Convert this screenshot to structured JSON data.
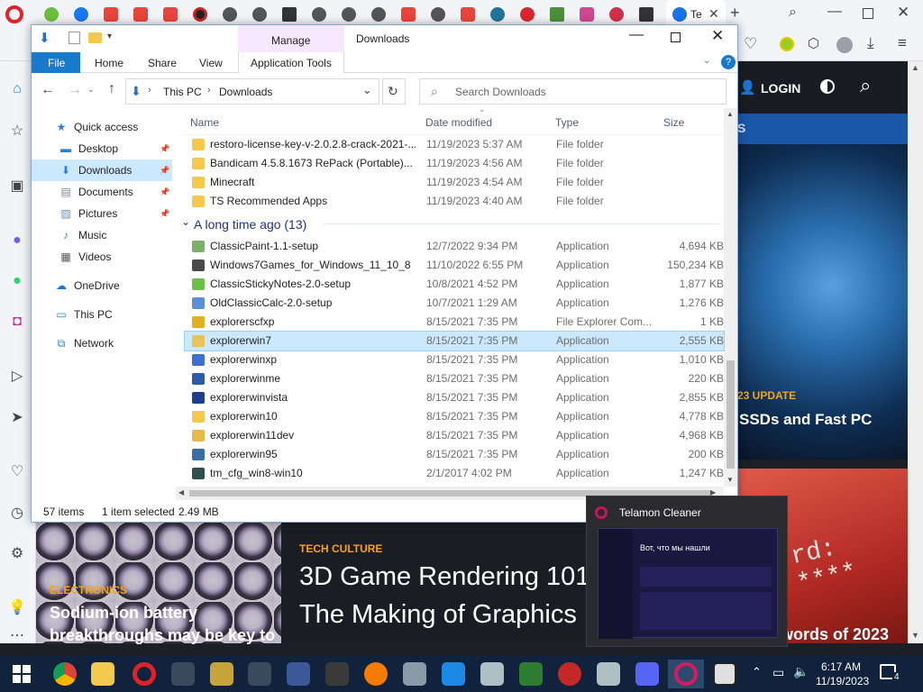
{
  "browser": {
    "active_tab_label": "Te",
    "login_label": "LOGIN"
  },
  "website": {
    "banner_partial": "S",
    "update_label": "23 UPDATE",
    "ssd_title": "SSDs and Fast PC",
    "card1": {
      "category": "ELECTRONICS",
      "title_line1": "Sodium-ion battery",
      "title_line2": "breakthroughs may be key to"
    },
    "card2": {
      "category": "TECH CULTURE",
      "title_line1": "3D Game Rendering 101:",
      "title_line2": "The Making of Graphics"
    },
    "card3": {
      "password_text": "rd: ****",
      "title": "words of 2023"
    }
  },
  "explorer": {
    "ribbon_manage": "Manage",
    "window_title": "Downloads",
    "ribbon_tabs": [
      "File",
      "Home",
      "Share",
      "View",
      "Application Tools"
    ],
    "breadcrumb": [
      "This PC",
      "Downloads"
    ],
    "search_placeholder": "Search Downloads",
    "columns": {
      "name": "Name",
      "date": "Date modified",
      "type": "Type",
      "size": "Size"
    },
    "group_label": "A long time ago (13)",
    "nav": [
      {
        "label": "Quick access",
        "icon": "star-icon"
      },
      {
        "label": "Desktop",
        "icon": "desktop-icon"
      },
      {
        "label": "Downloads",
        "icon": "download-icon"
      },
      {
        "label": "Documents",
        "icon": "documents-icon"
      },
      {
        "label": "Pictures",
        "icon": "pictures-icon"
      },
      {
        "label": "Music",
        "icon": "music-icon"
      },
      {
        "label": "Videos",
        "icon": "videos-icon"
      },
      {
        "label": "OneDrive",
        "icon": "cloud-icon"
      },
      {
        "label": "This PC",
        "icon": "pc-icon"
      },
      {
        "label": "Network",
        "icon": "network-icon"
      }
    ],
    "recent_files": [
      {
        "name": "restoro-license-key-v-2.0.2.8-crack-2021-...",
        "date": "11/19/2023 5:37 AM",
        "type": "File folder",
        "size": "",
        "color": "#f2c94c"
      },
      {
        "name": "Bandicam 4.5.8.1673 RePack (Portable)...",
        "date": "11/19/2023 4:56 AM",
        "type": "File folder",
        "size": "",
        "color": "#f2c94c"
      },
      {
        "name": "Minecraft",
        "date": "11/19/2023 4:54 AM",
        "type": "File folder",
        "size": "",
        "color": "#f2c94c"
      },
      {
        "name": "TS Recommended Apps",
        "date": "11/19/2023 4:40 AM",
        "type": "File folder",
        "size": "",
        "color": "#f2c94c"
      }
    ],
    "old_files": [
      {
        "name": "ClassicPaint-1.1-setup",
        "date": "12/7/2022 9:34 PM",
        "type": "Application",
        "size": "4,694 KB",
        "color": "#7fb069"
      },
      {
        "name": "Windows7Games_for_Windows_11_10_8",
        "date": "11/10/2022 6:55 PM",
        "type": "Application",
        "size": "150,234 KB",
        "color": "#4a4a4a"
      },
      {
        "name": "ClassicStickyNotes-2.0-setup",
        "date": "10/8/2021 4:52 PM",
        "type": "Application",
        "size": "1,877 KB",
        "color": "#6cc04a"
      },
      {
        "name": "OldClassicCalc-2.0-setup",
        "date": "10/7/2021 1:29 AM",
        "type": "Application",
        "size": "1,276 KB",
        "color": "#5b8fd6"
      },
      {
        "name": "explorerscfxp",
        "date": "8/15/2021 7:35 PM",
        "type": "File Explorer Com...",
        "size": "1 KB",
        "color": "#e0b020"
      },
      {
        "name": "explorerwin7",
        "date": "8/15/2021 7:35 PM",
        "type": "Application",
        "size": "2,555 KB",
        "color": "#e8c35a"
      },
      {
        "name": "explorerwinxp",
        "date": "8/15/2021 7:35 PM",
        "type": "Application",
        "size": "1,010 KB",
        "color": "#3b6fd1"
      },
      {
        "name": "explorerwinme",
        "date": "8/15/2021 7:35 PM",
        "type": "Application",
        "size": "220 KB",
        "color": "#2e5aa8"
      },
      {
        "name": "explorerwinvista",
        "date": "8/15/2021 7:35 PM",
        "type": "Application",
        "size": "2,855 KB",
        "color": "#1f3f8a"
      },
      {
        "name": "explorerwin10",
        "date": "8/15/2021 7:35 PM",
        "type": "Application",
        "size": "4,778 KB",
        "color": "#f2c94c"
      },
      {
        "name": "explorerwin11dev",
        "date": "8/15/2021 7:35 PM",
        "type": "Application",
        "size": "4,968 KB",
        "color": "#e8b84a"
      },
      {
        "name": "explorerwin95",
        "date": "8/15/2021 7:35 PM",
        "type": "Application",
        "size": "200 KB",
        "color": "#3a6ea5"
      },
      {
        "name": "tm_cfg_win8-win10",
        "date": "2/1/2017 4:02 PM",
        "type": "Application",
        "size": "1,247 KB",
        "color": "#2f4f4f"
      }
    ],
    "selected_index": 5,
    "status": {
      "items": "57 items",
      "selected": "1 item selected",
      "size": "2.49 MB"
    }
  },
  "preview": {
    "title": "Telamon Cleaner",
    "heading": "Вот, что мы нашли"
  },
  "taskbar": {
    "time": "6:17 AM",
    "date": "11/19/2023",
    "notification_count": "4"
  }
}
